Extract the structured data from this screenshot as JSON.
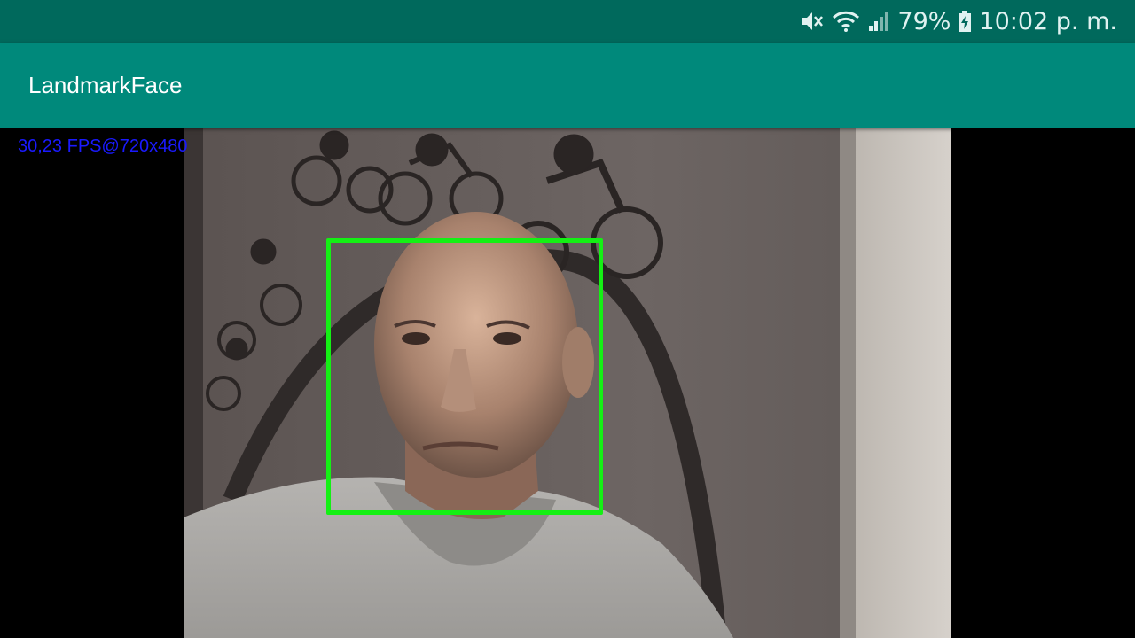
{
  "status_bar": {
    "battery_percent": "79%",
    "time": "10:02 p. m.",
    "icons": [
      "mute-icon",
      "wifi-icon",
      "signal-icon",
      "battery-charging-icon"
    ]
  },
  "app_bar": {
    "title": "LandmarkFace"
  },
  "camera": {
    "fps_text": "30,23 FPS@720x480",
    "detection_box_color": "#14f014"
  },
  "colors": {
    "status_bar_bg": "#00695c",
    "app_bar_bg": "#00897b",
    "fps_text": "#1a1aff"
  }
}
